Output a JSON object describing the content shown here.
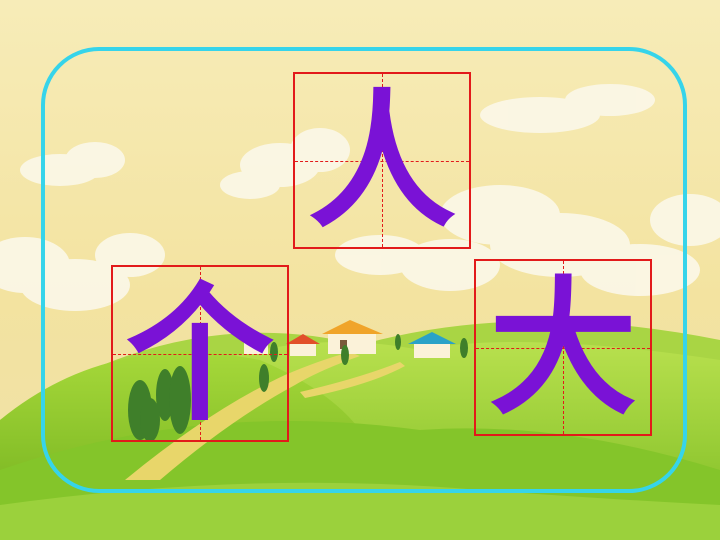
{
  "characters": {
    "top": "人",
    "left": "个",
    "right": "大"
  },
  "colors": {
    "glyph": "#7a12d6",
    "grid_border": "#e21a1a",
    "frame": "#36d4ea",
    "sky_top": "#f6e6a6",
    "grass": "#8bc52a"
  }
}
